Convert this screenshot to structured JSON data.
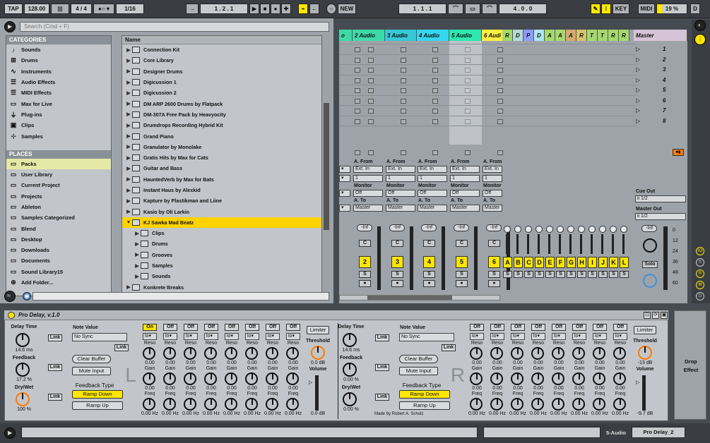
{
  "transport": {
    "tap": "TAP",
    "tempo": "128.00",
    "signature": "4 / 4",
    "quantize": "1/16",
    "position": "1 .  2 .  1",
    "new": "NEW",
    "loop_start": "1 .  1 .  1",
    "loop_length": "4 .  0 .  0",
    "key": "KEY",
    "midi": "MIDI",
    "cpu": "19 %",
    "d": "D"
  },
  "browser": {
    "search_placeholder": "Search (Cmd + F)",
    "categories_title": "CATEGORIES",
    "categories": [
      "Sounds",
      "Drums",
      "Instruments",
      "Audio Effects",
      "MIDI Effects",
      "Max for Live",
      "Plug-ins",
      "Clips",
      "Samples"
    ],
    "places_title": "PLACES",
    "places": [
      "Packs",
      "User Library",
      "Current Project",
      "Projects",
      "Ableton",
      "Samples Categorized",
      "Blend",
      "Desktop",
      "Downloads",
      "Documents",
      "Sound Library15",
      "Add Folder..."
    ],
    "list_header": "Name",
    "items": [
      "Connection Kit",
      "Core Library",
      "Designer Drums",
      "Digicussion 1",
      "Digicussion 2",
      "DM ARP 2600 Drums by Flatpack",
      "DM-307A Free Pack by Heavyocity",
      "Drumdrops Recording Hybrid Kit",
      "Grand Piano",
      "Granulator by Monolake",
      "Gratis Hits by Max for Cats",
      "Guitar and Bass",
      "HauntedVerb by Max for Bats",
      "Instant Haus by Alexkid",
      "Kapture by Plastikman and Liine",
      "Kasio by Oli Larkin",
      "KJ Sawka Mad Beatz"
    ],
    "subitems": [
      "Clips",
      "Drums",
      "Grooves",
      "Samples",
      "Sounds"
    ],
    "last_item": "Konkrete Breaks"
  },
  "session": {
    "tracks": [
      {
        "label": "o",
        "color": "#3fd9a8"
      },
      {
        "label": "2 Audio",
        "color": "#3fd9a8"
      },
      {
        "label": "3 Audio",
        "color": "#39c7d6"
      },
      {
        "label": "4 Audio",
        "color": "#36d6f0"
      },
      {
        "label": "5 Audio",
        "color": "#2ee8b0"
      },
      {
        "label": "6 Audi",
        "color": "#ffee40"
      }
    ],
    "mini_tracks": [
      {
        "label": "R",
        "color": "#a6d86d"
      },
      {
        "label": "D",
        "color": "#b4dcd7"
      },
      {
        "label": "P",
        "color": "#8c9cff"
      },
      {
        "label": "D",
        "color": "#aee6f2"
      },
      {
        "label": "A",
        "color": "#a6d86d"
      },
      {
        "label": "A",
        "color": "#a6d86d"
      },
      {
        "label": "A",
        "color": "#d7a86f"
      },
      {
        "label": "R",
        "color": "#d7c46f"
      },
      {
        "label": "T",
        "color": "#a6d86d"
      },
      {
        "label": "T",
        "color": "#a6d86d"
      },
      {
        "label": "R",
        "color": "#a6d86d"
      },
      {
        "label": "R",
        "color": "#a6d86d"
      }
    ],
    "master_label": "Master",
    "scenes": [
      "1",
      "2",
      "3",
      "4",
      "5",
      "6",
      "7",
      "8"
    ],
    "a_from": "A. From",
    "ext_in": "Ext. In",
    "one": "1",
    "monitor": "Monitor",
    "off": "Off",
    "a_to": "A. To",
    "master": "Master",
    "inf": "-Inf",
    "c": "C",
    "s": "S",
    "track_numbers": [
      "2",
      "3",
      "4",
      "5",
      "6"
    ],
    "mini_letters": [
      "A",
      "B",
      "C",
      "D",
      "E",
      "F",
      "G",
      "H",
      "I",
      "J",
      "K",
      "L"
    ],
    "cue_out": "Cue Out",
    "cue_val": "ii 1/2",
    "master_out": "Master Out",
    "master_val": "ii 1/2",
    "db_scale": [
      "0",
      "12",
      "24",
      "36",
      "48",
      "60"
    ],
    "solo": "Solo"
  },
  "device": {
    "title": "Pro Delay, v.1.0",
    "delay_time": "Delay Time",
    "delay_ms": "14.6 ms",
    "link": "Link",
    "note_value": "Note Value",
    "no_sync": "No Sync",
    "feedback": "Feedback",
    "feedback_l": "17.2 %",
    "feedback_r": "0.00 %",
    "clear_buffer": "Clear Buffer",
    "mute_input": "Mute Input",
    "dry_wet": "Dry/Wet",
    "dry_wet_l": "100 %",
    "dry_wet_r": "0.00 %",
    "feedback_type": "Feedback Type",
    "ramp_down": "Ramp Down",
    "ramp_up": "Ramp Up",
    "on": "On",
    "off": "Off",
    "reso": "Reso",
    "gain": "Gain",
    "freq": "Freq",
    "zero": "0.00",
    "hz": "0.00 Hz",
    "limiter": "Limiter",
    "threshold": "Threshold",
    "threshold_l": "0.0 dB",
    "threshold_r": "-13 dB",
    "volume": "Volume",
    "volume_l": "0.0 dB",
    "volume_r": "-9.7 dB",
    "l": "L",
    "r": "R",
    "credit": "Made by Robert A. Schulz",
    "drop_effect": "Drop Effect"
  },
  "status": {
    "track": "5-Audio",
    "device": "Pro Delay_2"
  }
}
